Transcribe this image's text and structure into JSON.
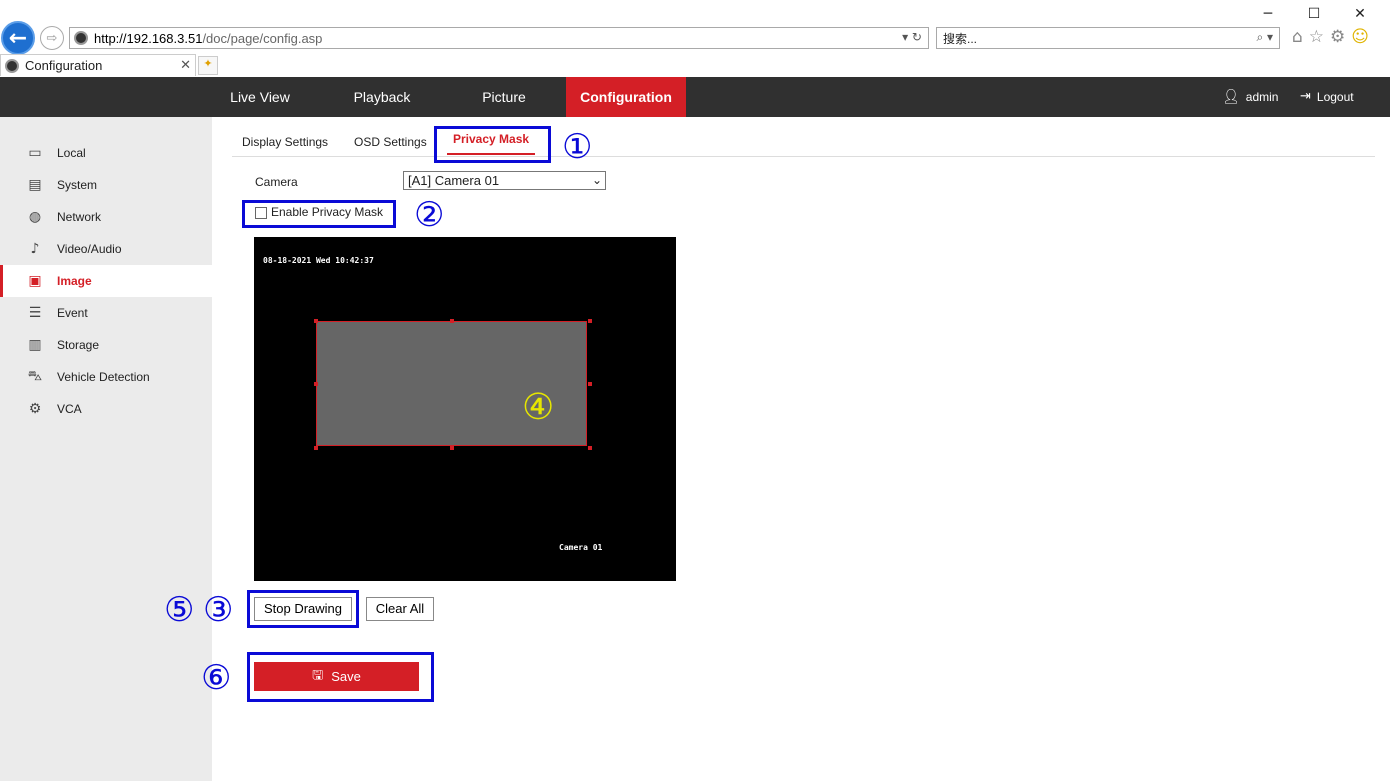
{
  "browser": {
    "url_host": "http://192.168.3.51",
    "url_path": "/doc/page/config.asp",
    "search_placeholder": "搜索...",
    "tab_title": "Configuration",
    "window_controls": [
      "─",
      "☐",
      "✕"
    ]
  },
  "topnav": {
    "items": [
      "Live View",
      "Playback",
      "Picture",
      "Configuration"
    ],
    "active": "Configuration",
    "user": "admin",
    "logout": "Logout"
  },
  "sidebar": {
    "items": [
      {
        "label": "Local",
        "icon": "monitor-icon"
      },
      {
        "label": "System",
        "icon": "system-icon"
      },
      {
        "label": "Network",
        "icon": "globe-icon"
      },
      {
        "label": "Video/Audio",
        "icon": "video-audio-icon"
      },
      {
        "label": "Image",
        "icon": "image-icon"
      },
      {
        "label": "Event",
        "icon": "event-icon"
      },
      {
        "label": "Storage",
        "icon": "storage-icon"
      },
      {
        "label": "Vehicle Detection",
        "icon": "vehicle-detection-icon"
      },
      {
        "label": "VCA",
        "icon": "vca-icon"
      }
    ],
    "active": "Image"
  },
  "subtabs": [
    "Display Settings",
    "OSD Settings",
    "Privacy Mask"
  ],
  "active_subtab": "Privacy Mask",
  "form": {
    "camera_label": "Camera",
    "camera_value": "[A1] Camera 01",
    "enable_label": "Enable Privacy Mask",
    "enable_checked": false
  },
  "video": {
    "timestamp": "08-18-2021 Wed 10:42:37",
    "camera_name": "Camera 01"
  },
  "buttons": {
    "stop_drawing": "Stop Drawing",
    "clear_all": "Clear All",
    "save": "Save"
  },
  "annotations": {
    "c1": "①",
    "c2": "②",
    "c3": "③",
    "c4": "④",
    "c5": "⑤",
    "c6": "⑥"
  },
  "colors": {
    "accent": "#d41f26",
    "nav_bg": "#303030",
    "highlight": "#0a0ad6",
    "annotation_4": "#e6e600"
  }
}
